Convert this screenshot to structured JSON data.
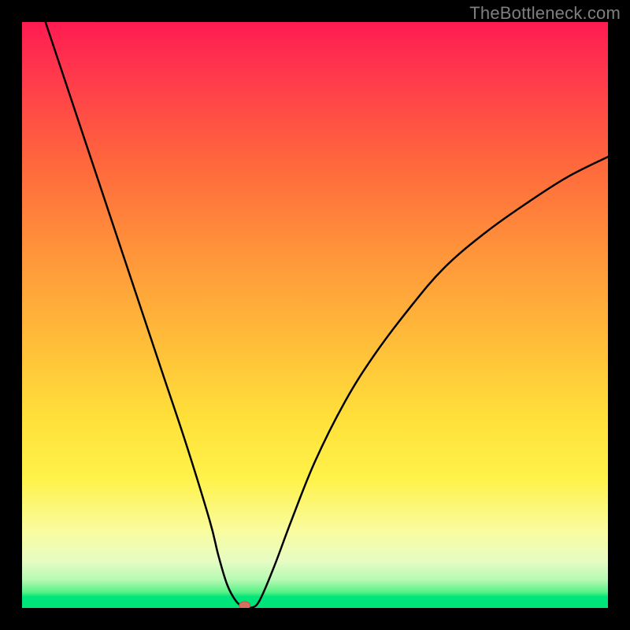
{
  "watermark": "TheBottleneck.com",
  "colors": {
    "frame": "#000000",
    "curve": "#000000",
    "marker_fill": "#d96f5f",
    "marker_stroke": "#b85a4c",
    "gradient_stops": [
      "#ff1b52",
      "#ff3c4b",
      "#ff6a3c",
      "#ff963a",
      "#ffbe39",
      "#ffe13a",
      "#fff24a",
      "#f9fca0",
      "#e6fcc3",
      "#b6f9b3",
      "#58f287",
      "#00e57a"
    ]
  },
  "chart_data": {
    "type": "line",
    "title": "",
    "xlabel": "",
    "ylabel": "",
    "xlim": [
      0,
      100
    ],
    "ylim": [
      0,
      100
    ],
    "annotations": [
      "TheBottleneck.com"
    ],
    "marker": {
      "x": 38,
      "y": 0
    },
    "series": [
      {
        "name": "bottleneck-curve",
        "x": [
          4,
          8,
          12,
          16,
          20,
          24,
          28,
          32,
          33.5,
          35,
          36.5,
          38,
          39,
          40.5,
          43,
          46,
          50,
          55,
          60,
          66,
          72,
          79,
          86,
          93,
          100
        ],
        "y": [
          100,
          88,
          76,
          64,
          52,
          40,
          28,
          15,
          9,
          4,
          1.2,
          0,
          0,
          1.2,
          7,
          15,
          25,
          35,
          43,
          51,
          58,
          64,
          69,
          73.5,
          77
        ]
      }
    ]
  }
}
